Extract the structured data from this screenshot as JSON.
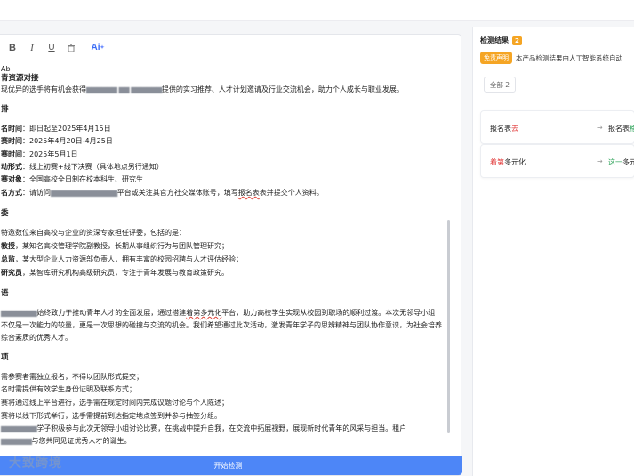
{
  "toolbar": {
    "bold_label": "B",
    "italic_label": "I",
    "underline_label": "U",
    "ai_label": "Ai"
  },
  "doc": {
    "tiny_label": "Ab",
    "sec1_heading": "青资源对接",
    "sec1_line_a": "现优异的选手将有机会获得",
    "sec1_line_blur": "▆▆▆▆▆▆ ▆▆ ▆▆▆▆▆▆",
    "sec1_line_b": "提供的实习推荐、人才计划邀请及行业交流机会，助力个人成长与职业发展。",
    "sec2_heading": "排",
    "schedule": [
      {
        "label": "名时间",
        "value": "：即日起至2025年4月15日"
      },
      {
        "label": "赛时间",
        "value": "：2025年4月20日-4月25日"
      },
      {
        "label": "赛时间",
        "value": "：2025年5月1日"
      },
      {
        "label": "动形式",
        "value": "：线上初赛+线下决赛（具体地点另行通知）"
      },
      {
        "label": "赛对象",
        "value": "：全国高校全日制在校本科生、研究生"
      }
    ],
    "signup_label": "名方式",
    "signup_a": "：请访问",
    "signup_blur": "▆▆▆▆▆▆▆▆▆▆▆▆▆",
    "signup_b": "平台或关注其官方社交媒体账号，填写",
    "signup_err": "报名表",
    "signup_c": "表并提交个人资料。",
    "sec3_heading": "委",
    "judges_intro": "特邀数位来自高校与企业的资深专家担任评委，包括的是：",
    "judges": [
      {
        "label": "教授",
        "value": "，某知名高校管理学院副教授，长期从事组织行为与团队管理研究；"
      },
      {
        "label": "总监",
        "value": "，某大型企业人力资源部负责人，拥有丰富的校园招聘与人才评估经验；"
      },
      {
        "label": "研究员",
        "value": "，某智库研究机构高级研究员，专注于青年发展与教育政策研究。"
      }
    ],
    "sec4_heading": "语",
    "closing_blur": "▆▆▆▆▆▆▆",
    "closing_a": "始终致力于推动青年人才的全面发展，通过搭建",
    "closing_err": "着第多元化",
    "closing_b": "平台，助力高校学生实现从校园到职场的顺利过渡。本次无领导小组",
    "closing_line2": "不仅是一次能力的较量，更是一次思想的碰撞与交流的机会。我们希望通过此次活动，激发青年学子的思辨精神与团队协作意识，为社会培养",
    "closing_line3": "综合素质的优秀人才。",
    "sec5_heading": "项",
    "notes": [
      "需参赛者需独立报名，不得以团队形式提交；",
      "名时需提供有效学生身份证明及联系方式；",
      "赛将通过线上平台进行，选手需在规定时间内完成议题讨论与个人陈述；",
      "赛将以线下形式举行，选手需提前到达指定地点签到并参与抽签分组。"
    ],
    "final_blur": "▆▆▆▆▆▆▆",
    "final_a": "学子积极参与此次无领导小组讨论比赛，在挑战中提升自我，在交流中拓展视野，展现新时代青年的风采与担当。租户",
    "final_blur2": "▆▆▆▆▆▆",
    "final_b": "与您共同见证优秀人才的诞生。"
  },
  "start_button": "开始检测",
  "watermark": "大致跨境",
  "panel": {
    "title": "检测结果",
    "count": "2",
    "notice_tag": "免责声明",
    "notice_text": "本产品检测结果由人工智能系统自动",
    "filter_tab": "全部 2",
    "results": [
      {
        "orig_a": "报名表",
        "orig_err": "去",
        "orig_b": "",
        "arrow": "→",
        "sugg_a": "报名表",
        "sugg_fix": "格"
      },
      {
        "orig_a": "",
        "orig_err": "着第",
        "orig_b": "多元化",
        "arrow": "→",
        "sugg_a": "",
        "sugg_fix": "这一",
        "sugg_b": "多元"
      }
    ]
  },
  "colors": {
    "accent": "#4d86f7",
    "badge": "#f5a524",
    "error": "#e23b3b",
    "fix": "#2fa35a"
  }
}
